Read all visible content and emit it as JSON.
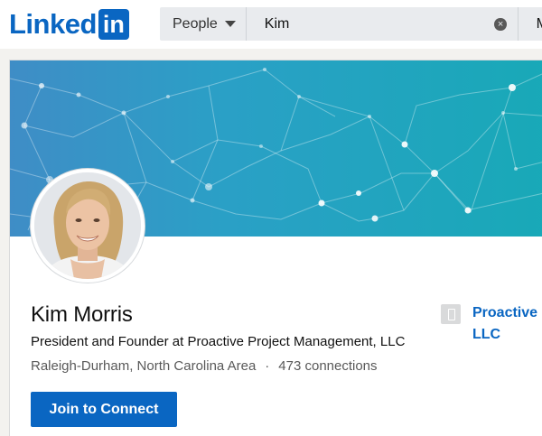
{
  "header": {
    "logo_text": "Linked",
    "logo_box": "in",
    "search_category": "People",
    "search_value": "Kim",
    "search_next_partial": "M"
  },
  "profile": {
    "name": "Kim Morris",
    "headline": "President and Founder at Proactive Project Management, LLC",
    "location": "Raleigh-Durham, North Carolina Area",
    "separator": "·",
    "connections": "473 connections",
    "connect_button": "Join to Connect",
    "company_line1": "Proactive P",
    "company_line2": "LLC"
  },
  "colors": {
    "brand": "#0a66c2",
    "banner_start": "#3f8dc6",
    "banner_end": "#18a9b7"
  }
}
